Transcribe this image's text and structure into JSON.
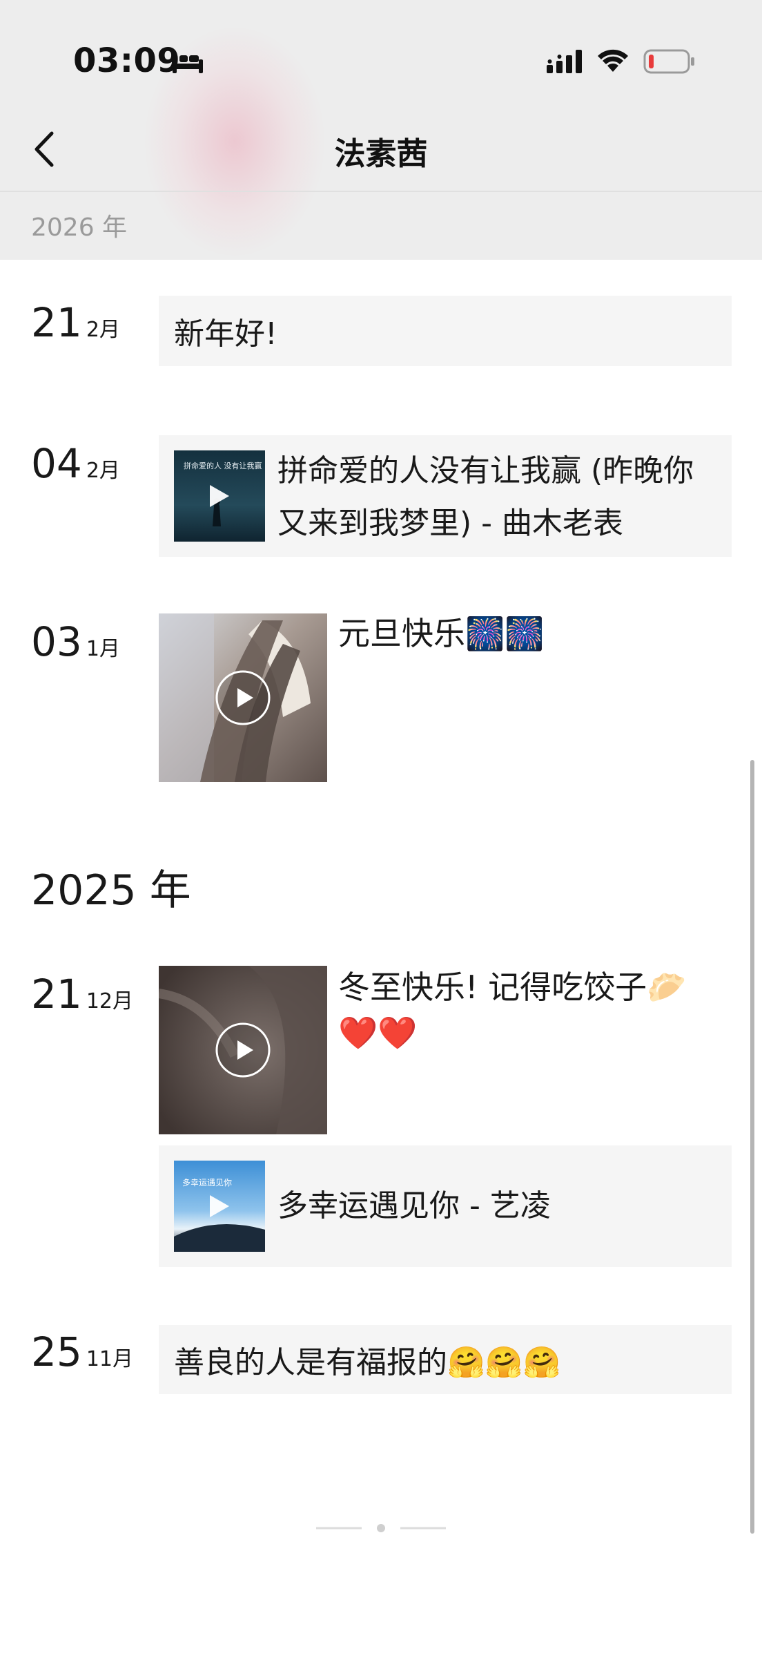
{
  "status_bar": {
    "time": "03:09",
    "battery_color": "#e83b3b"
  },
  "nav": {
    "title": "法素茜",
    "back_icon": "chevron-left-icon"
  },
  "sticky_year": "2026 年",
  "year_2025": "2025 年",
  "entries": [
    {
      "day": "21",
      "month": "2月",
      "text": "新年好!"
    },
    {
      "day": "04",
      "month": "2月",
      "music_title": "拼命爱的人没有让我赢 (昨晚你又来到我梦里) - 曲木老表",
      "cover_text": "拼命爱的人 没有让我赢"
    },
    {
      "day": "03",
      "month": "1月",
      "text": "元旦快乐🎆🎆"
    },
    {
      "day": "21",
      "month": "12月",
      "text_line1": "冬至快乐!  记得吃饺子🥟",
      "text_line2": "❤️❤️",
      "music_title": "多幸运遇见你 - 艺凌",
      "cover_text": "多幸运遇见你"
    },
    {
      "day": "25",
      "month": "11月",
      "text": "善良的人是有福报的🤗🤗🤗"
    }
  ]
}
